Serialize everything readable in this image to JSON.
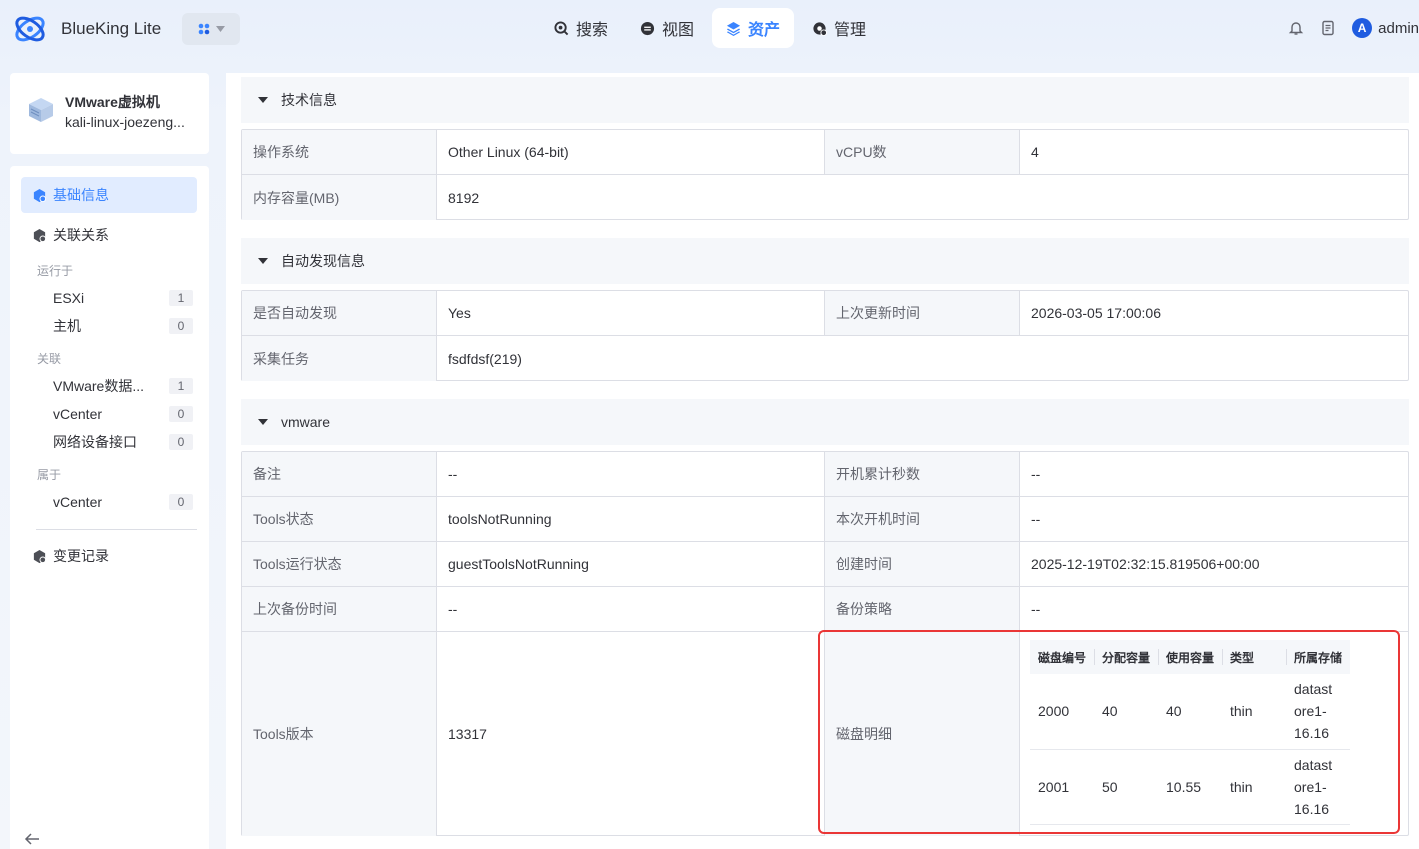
{
  "header": {
    "brand": "BlueKing Lite",
    "nav": [
      {
        "label": "搜索",
        "icon": "search-icon"
      },
      {
        "label": "视图",
        "icon": "view-icon"
      },
      {
        "label": "资产",
        "icon": "layers-icon"
      },
      {
        "label": "管理",
        "icon": "gear-icon"
      }
    ],
    "active_nav": "资产",
    "user": {
      "initial": "A",
      "name": "admin"
    }
  },
  "object": {
    "type": "VMware虚拟机",
    "name": "kali-linux-joezeng..."
  },
  "sidebar": {
    "menu": {
      "basic": "基础信息",
      "relations": "关联关系",
      "changelog": "变更记录"
    },
    "groups": [
      {
        "label": "运行于",
        "items": [
          {
            "name": "ESXi",
            "count": "1"
          },
          {
            "name": "主机",
            "count": "0"
          }
        ]
      },
      {
        "label": "关联",
        "items": [
          {
            "name": "VMware数据...",
            "count": "1"
          },
          {
            "name": "vCenter",
            "count": "0"
          },
          {
            "name": "网络设备接口",
            "count": "0"
          }
        ]
      },
      {
        "label": "属于",
        "items": [
          {
            "name": "vCenter",
            "count": "0"
          }
        ]
      }
    ]
  },
  "sections": {
    "tech": {
      "title": "技术信息",
      "rows": [
        {
          "k1": "操作系统",
          "v1": "Other Linux (64-bit)",
          "k2": "vCPU数",
          "v2": "4"
        },
        {
          "k1": "内存容量(MB)",
          "v1": "8192"
        }
      ]
    },
    "discovery": {
      "title": "自动发现信息",
      "rows": [
        {
          "k1": "是否自动发现",
          "v1": "Yes",
          "k2": "上次更新时间",
          "v2": "2026-03-05 17:00:06"
        },
        {
          "k1": "采集任务",
          "v1": "fsdfdsf(219)"
        }
      ]
    },
    "vmware": {
      "title": "vmware",
      "rows": [
        {
          "k1": "备注",
          "v1": "--",
          "k2": "开机累计秒数",
          "v2": "--"
        },
        {
          "k1": "Tools状态",
          "v1": "toolsNotRunning",
          "k2": "本次开机时间",
          "v2": "--"
        },
        {
          "k1": "Tools运行状态",
          "v1": "guestToolsNotRunning",
          "k2": "创建时间",
          "v2": "2025-12-19T02:32:15.819506+00:00"
        },
        {
          "k1": "上次备份时间",
          "v1": "--",
          "k2": "备份策略",
          "v2": "--"
        },
        {
          "k1": "Tools版本",
          "v1": "13317",
          "k2": "磁盘明细"
        }
      ],
      "disk_table": {
        "columns": [
          "磁盘编号",
          "分配容量",
          "使用容量",
          "类型",
          "所属存储"
        ],
        "rows": [
          [
            "2000",
            "40",
            "40",
            "thin",
            "datast ore1- 16.16"
          ],
          [
            "2001",
            "50",
            "10.55",
            "thin",
            "datast ore1- 16.16"
          ]
        ]
      }
    }
  },
  "colors": {
    "accent": "#3a84ff",
    "highlight": "#ea3636"
  }
}
